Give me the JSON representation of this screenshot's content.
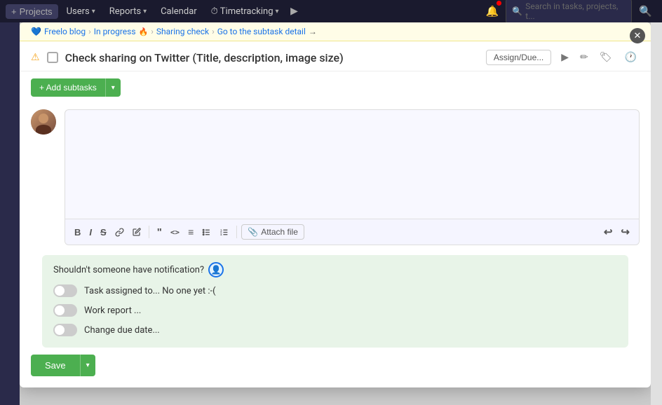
{
  "topbar": {
    "add_label": "+ Projects",
    "nav_items": [
      {
        "label": "Projects",
        "has_chevron": true
      },
      {
        "label": "Users",
        "has_chevron": true
      },
      {
        "label": "Reports",
        "has_chevron": true
      },
      {
        "label": "Calendar"
      },
      {
        "label": "⏱ Timetracking",
        "has_chevron": true
      }
    ],
    "search_placeholder": "Search in tasks, projects, t...",
    "colors": {
      "background": "#1a1a2e",
      "text": "#cccccc"
    }
  },
  "breadcrumb": {
    "heart_emoji": "💙",
    "project": "Freelo blog",
    "status": "In progress",
    "fire_emoji": "🔥",
    "section": "Sharing check",
    "action": "Go to the subtask detail",
    "arrow": "→"
  },
  "task": {
    "title": "Check sharing on Twitter (Title, description, image size)",
    "assign_btn_label": "Assign/Due...",
    "actions": [
      "▶",
      "✏",
      "🏷"
    ]
  },
  "subtasks": {
    "add_label": "+ Add subtasks",
    "dropdown_arrow": "▾"
  },
  "comment": {
    "toolbar": {
      "bold": "B",
      "italic": "I",
      "strikethrough": "S",
      "link": "🔗",
      "pen": "✏",
      "quote": "\"",
      "code": "<>",
      "align": "≡",
      "list_ul": "☰",
      "list_ol": "☷",
      "attach": "📎 Attach file",
      "undo": "↩",
      "redo": "↪"
    }
  },
  "notifications": {
    "title": "Shouldn't someone have notification?",
    "icon": "👤+",
    "rows": [
      {
        "label": "Task assigned to... No one yet :-(",
        "enabled": false
      },
      {
        "label": "Work report ...",
        "enabled": false
      },
      {
        "label": "Change due date...",
        "enabled": false
      }
    ]
  },
  "save": {
    "label": "Save",
    "dropdown_arrow": "▾"
  },
  "colors": {
    "green": "#4caf50",
    "nav_bg": "#1e1e3a",
    "modal_bg": "#ffffff",
    "breadcrumb_bg": "#fffde7"
  }
}
